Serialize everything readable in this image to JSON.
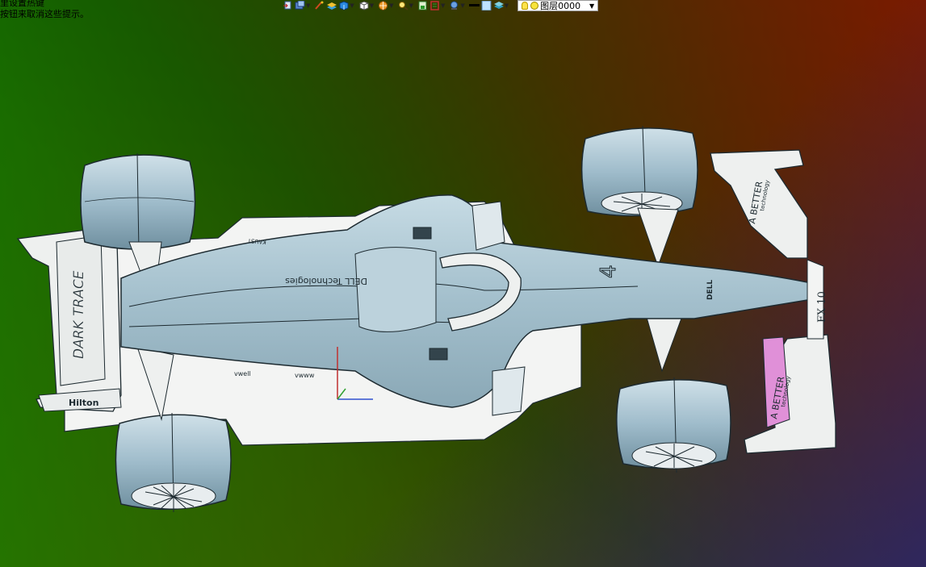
{
  "hint": {
    "line1": "里设置热键",
    "line2": "按钮来取消这些提示。"
  },
  "toolbar": {
    "buttons": [
      {
        "icon": "import-icon"
      },
      {
        "icon": "display-style-icon"
      },
      {
        "icon": "brush-icon"
      },
      {
        "icon": "layers-stack-icon"
      },
      {
        "icon": "shaded-cube-icon"
      },
      {
        "icon": "view-cube-icon"
      },
      {
        "icon": "render-sphere-icon"
      },
      {
        "icon": "zoom-icon"
      },
      {
        "icon": "save-view-icon"
      },
      {
        "icon": "frame-icon"
      },
      {
        "icon": "monitor-icon"
      },
      {
        "icon": "line-color-icon"
      },
      {
        "icon": "fill-color-icon"
      },
      {
        "icon": "layer-manager-icon"
      }
    ],
    "layer_select": {
      "value": "图层0000"
    }
  },
  "model": {
    "text": {
      "rear_wing": "DARK TRACE",
      "rear_plate": "Hilton",
      "sidepod": "DELL Technologies",
      "sponsor_small_1": "KAUST",
      "sponsor_small_2": "vwell",
      "sponsor_small_3": "vwww",
      "front_wing_top": "A BETTER",
      "front_wing_top_sub": "technology",
      "front_wing_bottom": "A BETTER",
      "front_wing_bottom_sub": "technology",
      "nose": "DELL",
      "nose_tip": "FX 10",
      "car_number": "4"
    },
    "colors": {
      "body": "#f2f3f2",
      "surface": "#a9c3cf",
      "edge": "#1d2a30",
      "accent_pink": "#e090d8"
    }
  }
}
